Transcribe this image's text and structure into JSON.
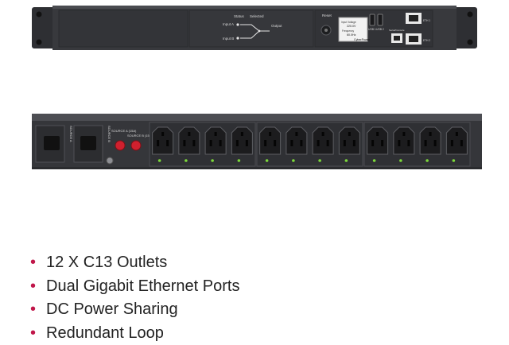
{
  "colors": {
    "background": "#ffffff",
    "chassis": "#3a3b3f",
    "chassis_dark": "#2a2b2e",
    "outlet_face": "#1c1c1e",
    "led": "#7cd83a",
    "breaker": "#d0202e",
    "bullet": "#c0174a",
    "text": "#222222"
  },
  "front_panel": {
    "diagram_labels": {
      "status": "Status",
      "selected": "Selected",
      "input_a": "Input A",
      "input_b": "Input B",
      "output": "Output"
    },
    "reset_label": "Reset",
    "lcd": {
      "line1": "Input Voltage",
      "value1": "220.0V",
      "line2": "Frequency",
      "value2": "60.0Hz",
      "brand": "CyberPower"
    },
    "usb_labels": [
      "USB 1",
      "USB 2"
    ],
    "port_labels": [
      "ETH 1",
      "ETH 2",
      "Serial/Console"
    ]
  },
  "rear_panel": {
    "inlet_labels": [
      "SOURCE A",
      "SOURCE B"
    ],
    "breaker_labels": [
      "SOURCE A (15A)",
      "SOURCE B (15A)"
    ],
    "outlet_count": 12,
    "outlet_groups": 3
  },
  "features": [
    "12 X C13 Outlets",
    "Dual Gigabit Ethernet Ports",
    "DC Power Sharing",
    "Redundant Loop"
  ],
  "bullet_char": "•"
}
